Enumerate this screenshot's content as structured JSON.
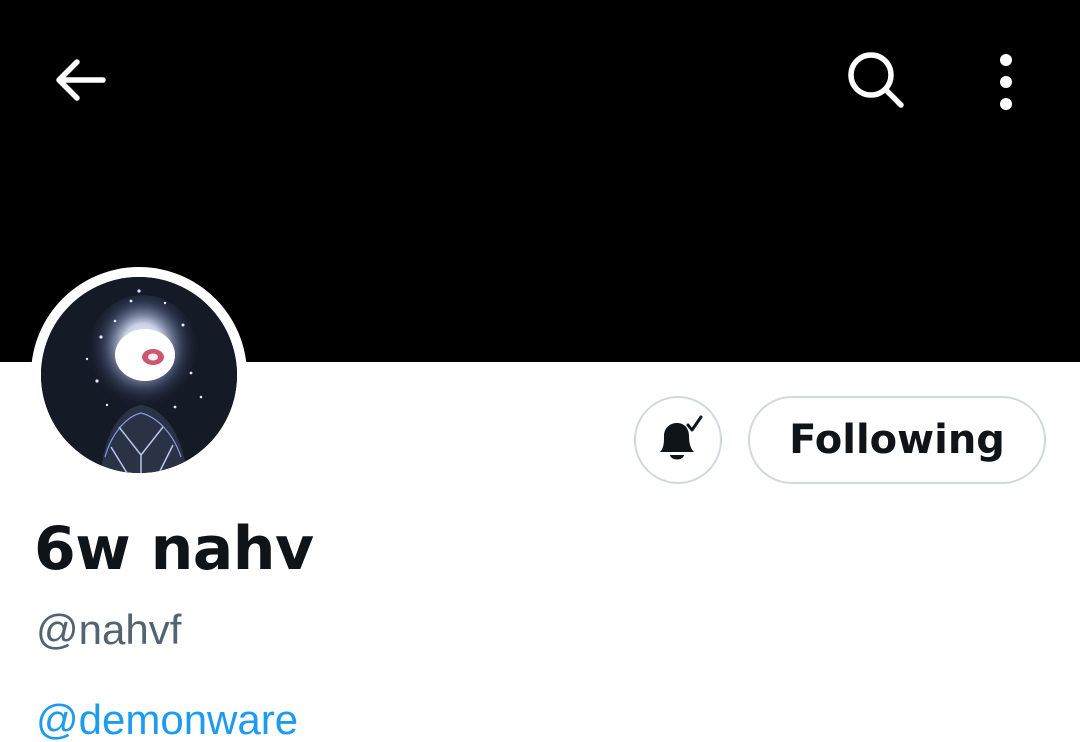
{
  "header": {
    "back_icon": "arrow-left-icon",
    "search_icon": "search-icon",
    "more_icon": "more-vertical-icon",
    "banner_color": "#000000"
  },
  "profile": {
    "avatar_icon": "profile-avatar-image",
    "display_name": "6w nahv",
    "handle": "@nahvf",
    "bio_mention": "@demonware"
  },
  "actions": {
    "notifications_icon": "bell-checked-icon",
    "following_label": "Following"
  },
  "colors": {
    "text_primary": "#0f1419",
    "text_secondary": "#536471",
    "link": "#1d9bf0",
    "button_border": "#cfd9de"
  }
}
